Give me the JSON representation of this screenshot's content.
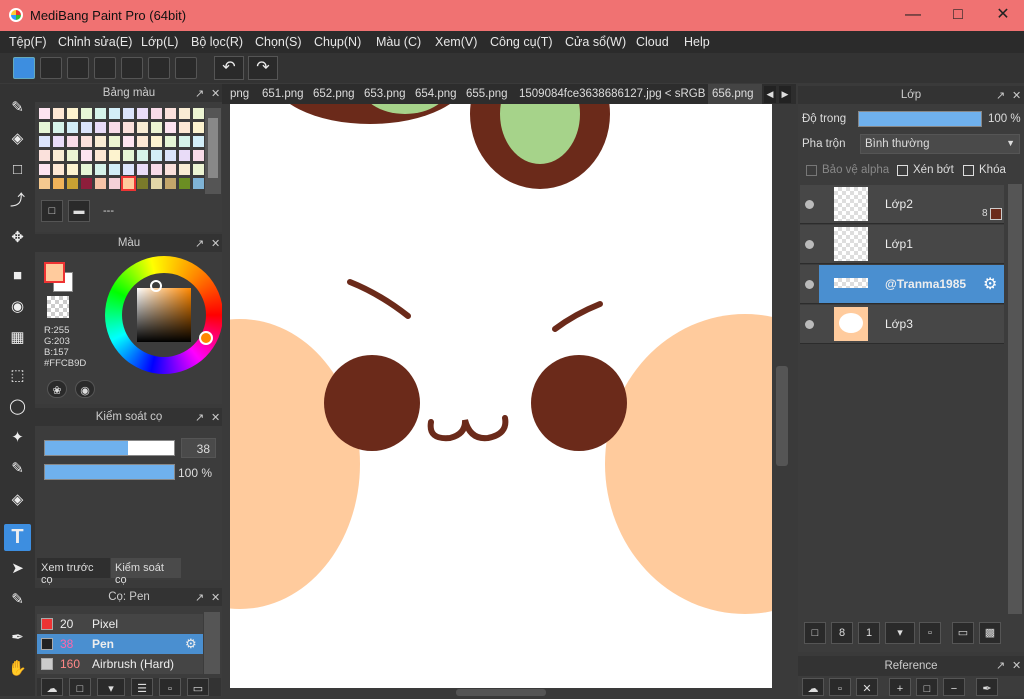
{
  "window": {
    "title": "MediBang Paint Pro (64bit)"
  },
  "menu": [
    "Tệp(F)",
    "Chỉnh sửa(E)",
    "Lớp(L)",
    "Bộ lọc(R)",
    "Chọn(S)",
    "Chụp(N)",
    "Màu (C)",
    "Xem(V)",
    "Công cụ(T)",
    "Cửa sổ(W)",
    "Cloud",
    "Help"
  ],
  "tabs": [
    "png",
    "651.png",
    "652.png",
    "653.png",
    "654.png",
    "655.png",
    "1509084fce3638686127.jpg < sRGB >",
    "656.png"
  ],
  "palette": {
    "title": "Bảng màu",
    "name": "---"
  },
  "color": {
    "title": "Màu",
    "r": "R:255",
    "g": "G:203",
    "b": "B:157",
    "hex": "#FFCB9D",
    "primary": "#FFCB9D"
  },
  "brushctl": {
    "title": "Kiểm soát cọ",
    "size": "38",
    "opacity": "100 %",
    "tab1": "Xem trước cọ",
    "tab2": "Kiểm soát cọ"
  },
  "brushes": {
    "title": "Cọ: Pen",
    "items": [
      {
        "size": "20",
        "name": "Pixel",
        "color": "#e33"
      },
      {
        "size": "38",
        "name": "Pen",
        "color": "#222"
      },
      {
        "size": "160",
        "name": "Airbrush (Hard)",
        "color": "#ccc"
      }
    ]
  },
  "layer": {
    "title": "Lớp",
    "opacity_label": "Độ trong",
    "opacity": "100 %",
    "blend_label": "Pha trộn",
    "blend": "Bình thường",
    "protect": "Bảo vệ alpha",
    "clip": "Xén bớt",
    "lock": "Khóa",
    "items": [
      {
        "name": "Lớp2",
        "badge": "8"
      },
      {
        "name": "Lớp1"
      },
      {
        "name": "@Tranma1985"
      },
      {
        "name": "Lớp3"
      }
    ]
  },
  "reference": {
    "title": "Reference"
  }
}
